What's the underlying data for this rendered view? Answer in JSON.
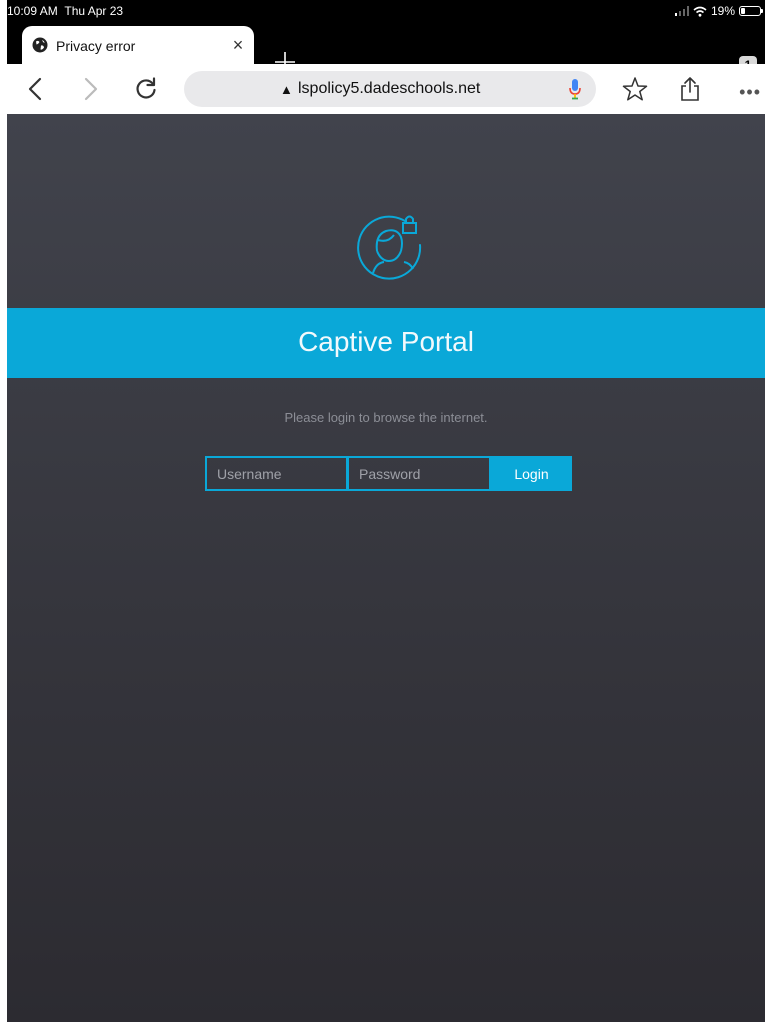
{
  "status_bar": {
    "time": "10:09 AM",
    "date": "Thu Apr 23",
    "battery": "19%"
  },
  "tabs": {
    "active_title": "Privacy error",
    "close_glyph": "×",
    "count": "1"
  },
  "toolbar": {
    "url": "lspolicy5.dadeschools.net",
    "warning_glyph": "▲",
    "more_glyph": "•••"
  },
  "portal": {
    "title": "Captive Portal",
    "prompt": "Please login to browse the internet.",
    "username_placeholder": "Username",
    "password_placeholder": "Password",
    "login_label": "Login"
  },
  "colors": {
    "accent": "#0aa8d8",
    "page_top": "#41434c",
    "page_bottom": "#2c2b31"
  }
}
